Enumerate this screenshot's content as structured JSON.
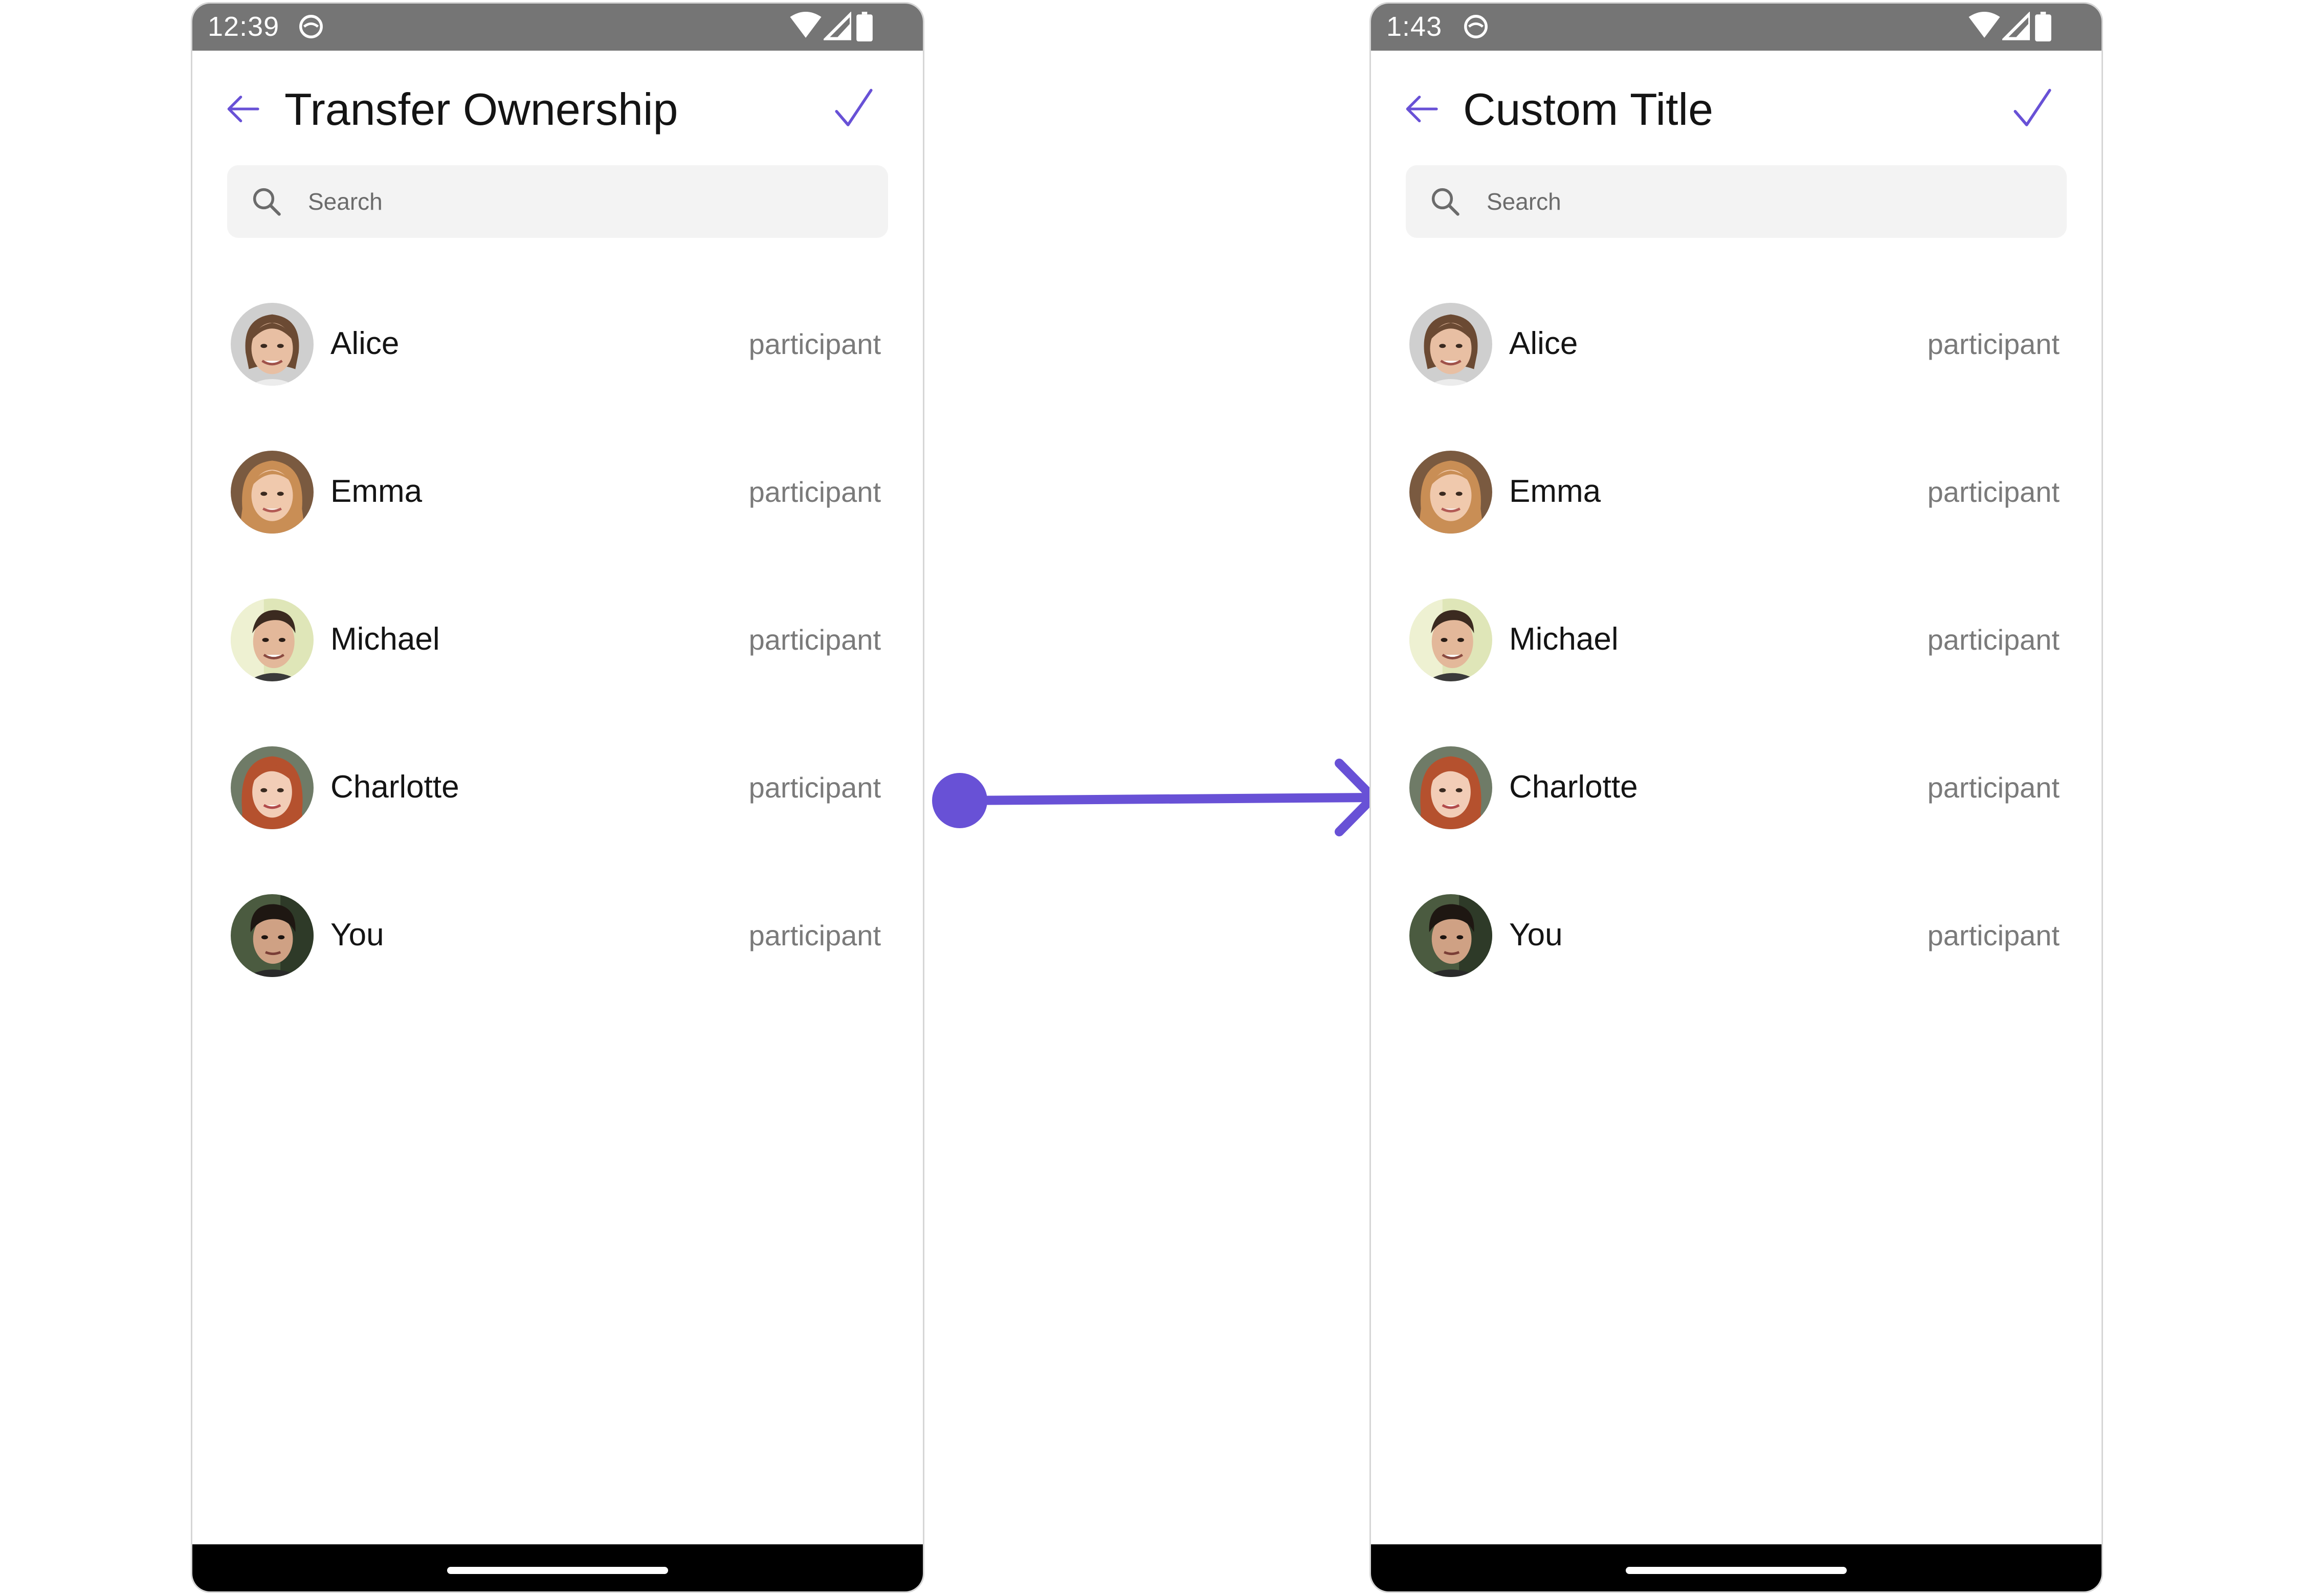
{
  "colors": {
    "accent": "#6851d6",
    "statusbar": "#757575",
    "navbar": "#000000",
    "search_bg": "#f3f3f3",
    "text_primary": "#141414",
    "text_secondary": "#7a7a7a"
  },
  "screens": [
    {
      "status": {
        "time": "12:39"
      },
      "header": {
        "title": "Transfer Ownership",
        "back_icon": "arrow-left-icon",
        "confirm_icon": "check-icon"
      },
      "search": {
        "placeholder": "Search",
        "icon": "search-icon"
      },
      "members": [
        {
          "name": "Alice",
          "role": "participant"
        },
        {
          "name": "Emma",
          "role": "participant"
        },
        {
          "name": "Michael",
          "role": "participant"
        },
        {
          "name": "Charlotte",
          "role": "participant"
        },
        {
          "name": "You",
          "role": "participant"
        }
      ]
    },
    {
      "status": {
        "time": "1:43"
      },
      "header": {
        "title": "Custom Title",
        "back_icon": "arrow-left-icon",
        "confirm_icon": "check-icon"
      },
      "search": {
        "placeholder": "Search",
        "icon": "search-icon"
      },
      "members": [
        {
          "name": "Alice",
          "role": "participant"
        },
        {
          "name": "Emma",
          "role": "participant"
        },
        {
          "name": "Michael",
          "role": "participant"
        },
        {
          "name": "Charlotte",
          "role": "participant"
        },
        {
          "name": "You",
          "role": "participant"
        }
      ]
    }
  ]
}
